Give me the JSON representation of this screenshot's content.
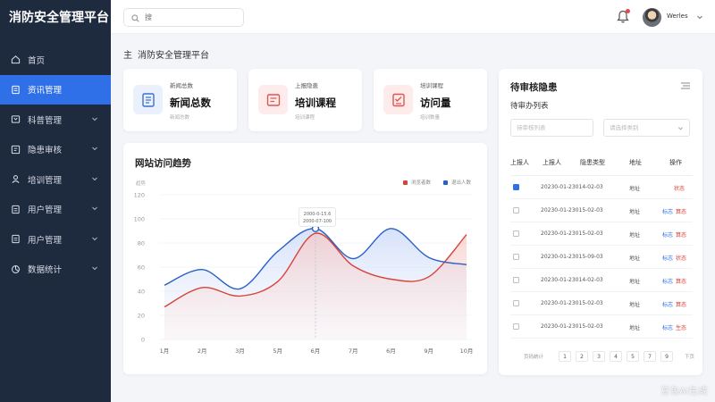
{
  "app": {
    "title": "消防安全管理平台"
  },
  "sidebar": {
    "items": [
      {
        "label": "首页",
        "icon": "home-icon",
        "active": false,
        "has_arrow": false
      },
      {
        "label": "资讯管理",
        "icon": "document-icon",
        "active": true,
        "has_arrow": false
      },
      {
        "label": "科普管理",
        "icon": "book-icon",
        "active": false,
        "has_arrow": true
      },
      {
        "label": "隐患审核",
        "icon": "audit-icon",
        "active": false,
        "has_arrow": true
      },
      {
        "label": "培训管理",
        "icon": "user-icon",
        "active": false,
        "has_arrow": true
      },
      {
        "label": "用户管理",
        "icon": "file-icon",
        "active": false,
        "has_arrow": true
      },
      {
        "label": "用户管理",
        "icon": "file-icon",
        "active": false,
        "has_arrow": true
      },
      {
        "label": "数据统计",
        "icon": "stats-icon",
        "active": false,
        "has_arrow": true
      }
    ]
  },
  "header": {
    "search_placeholder": "搜",
    "username": "Werles"
  },
  "breadcrumb": {
    "prefix": "主",
    "title": "消防安全管理平台"
  },
  "stats": [
    {
      "small": "新闻总数",
      "big": "新闻总数",
      "sub": "新闻总数",
      "icon": "news-icon",
      "accent": "#3a6fd8",
      "bg": "#eaf1fd"
    },
    {
      "small": "上报隐患",
      "big": "培训课程",
      "sub": "培训课程",
      "icon": "course-icon",
      "accent": "#e0554c",
      "bg": "#fdeceb"
    },
    {
      "small": "培训课程",
      "big": "访问量",
      "sub": "培训数量",
      "icon": "checklist-icon",
      "accent": "#e0554c",
      "bg": "#fdeceb"
    }
  ],
  "chart": {
    "tooltip_line1": "2000-0-15.6",
    "tooltip_line2": "2000-07-100"
  },
  "chart_data": {
    "type": "line",
    "title": "网站访问趋势",
    "ylabel": "趋势",
    "categories": [
      "1月",
      "2月",
      "3月",
      "5月",
      "6月",
      "7月",
      "6月",
      "9月",
      "10月"
    ],
    "ylim": [
      0,
      120
    ],
    "yticks": [
      0,
      20,
      40,
      60,
      80,
      100,
      120
    ],
    "grid": true,
    "legend_position": "top-right",
    "series": [
      {
        "name": "浏览者数",
        "color": "#d8433b",
        "values": [
          27,
          43,
          36,
          48,
          88,
          61,
          50,
          52,
          87
        ]
      },
      {
        "name": "退出人数",
        "color": "#2860c4",
        "values": [
          45,
          58,
          42,
          73,
          92,
          67,
          92,
          68,
          62
        ]
      }
    ]
  },
  "panel": {
    "title": "待审核隐患",
    "subtitle": "待审办列表",
    "filter1_placeholder": "待审核列表",
    "filter2_placeholder": "请选择类别",
    "columns": [
      "上报人",
      "上报人",
      "隐患类型",
      "地址",
      "操作"
    ],
    "rows": [
      {
        "time": "20230-01-23014-02-03",
        "addr": "地址",
        "link": "",
        "status": "状态",
        "checked": true
      },
      {
        "time": "20230-01-23015-02-03",
        "addr": "地址",
        "link": "标志",
        "status": "算态",
        "checked": false
      },
      {
        "time": "20230-01-23015-02-03",
        "addr": "地址",
        "link": "标志",
        "status": "算态",
        "checked": false
      },
      {
        "time": "20230-01-23015-09-03",
        "addr": "地址",
        "link": "标志",
        "status": "状态",
        "checked": false
      },
      {
        "time": "20230-01-23014-02-03",
        "addr": "地址",
        "link": "标志",
        "status": "算态",
        "checked": false
      },
      {
        "time": "20230-01-23015-02-03",
        "addr": "地址",
        "link": "标志",
        "status": "算态",
        "checked": false
      },
      {
        "time": "20230-01-23015-02-03",
        "addr": "地址",
        "link": "标志",
        "status": "生态",
        "checked": false
      }
    ],
    "pager": {
      "prefix": "页码统计",
      "pages": [
        "1",
        "2",
        "3",
        "4",
        "5",
        "7",
        "9"
      ],
      "suffix": "下页"
    }
  },
  "watermark": "豆包AI生成"
}
